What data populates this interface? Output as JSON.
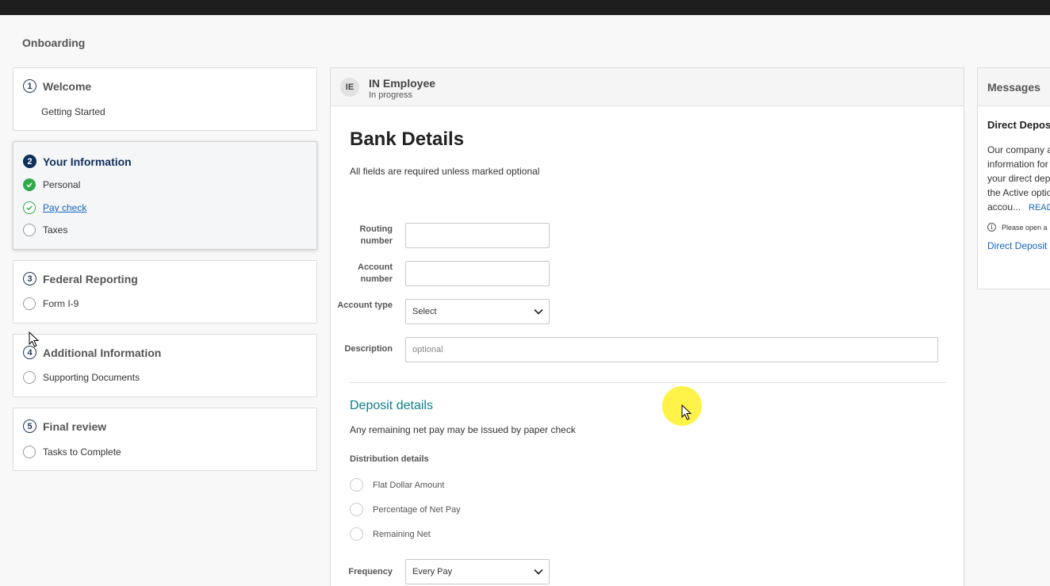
{
  "app": {
    "title": "Onboarding"
  },
  "steps": [
    {
      "number": "1",
      "title": "Welcome",
      "tasks": [
        {
          "label": "Getting Started",
          "status": "none"
        }
      ]
    },
    {
      "number": "2",
      "title": "Your Information",
      "active": true,
      "tasks": [
        {
          "label": "Personal",
          "status": "complete"
        },
        {
          "label": "Pay check",
          "status": "current"
        },
        {
          "label": "Taxes",
          "status": "pending"
        }
      ]
    },
    {
      "number": "3",
      "title": "Federal Reporting",
      "tasks": [
        {
          "label": "Form I-9",
          "status": "pending"
        }
      ]
    },
    {
      "number": "4",
      "title": "Additional Information",
      "tasks": [
        {
          "label": "Supporting Documents",
          "status": "pending"
        }
      ]
    },
    {
      "number": "5",
      "title": "Final review",
      "tasks": [
        {
          "label": "Tasks to Complete",
          "status": "pending"
        }
      ]
    }
  ],
  "employee": {
    "initials": "IE",
    "name": "IN Employee",
    "status": "In progress"
  },
  "form": {
    "title": "Bank Details",
    "subtitle": "All fields are required unless marked optional",
    "routing_label": "Routing number",
    "routing_value": "",
    "account_label": "Account number",
    "account_value": "",
    "type_label": "Account type",
    "type_value": "Select",
    "description_label": "Description",
    "description_placeholder": "optional"
  },
  "deposit": {
    "title": "Deposit details",
    "note": "Any remaining net pay may be issued by paper check",
    "distribution_label": "Distribution details",
    "options": [
      "Flat Dollar Amount",
      "Percentage of Net Pay",
      "Remaining Net"
    ],
    "frequency_label": "Frequency",
    "frequency_value": "Every Pay"
  },
  "messages": {
    "title": "Messages",
    "item_title": "Direct Deposit",
    "lines": [
      "Our company a",
      "information for",
      "your direct dep",
      "the Active optio",
      "accou..."
    ],
    "read_more": "READ MORE",
    "info_text": "Please open a",
    "link": "Direct Deposit"
  },
  "colors": {
    "brand_dark": "#0d2f5c",
    "success": "#2eaa4a",
    "link": "#1565c0",
    "section_heading": "#0e7e8e"
  },
  "icons": {
    "chevron": "chevron-down-icon",
    "check": "check-icon",
    "info": "info-icon",
    "cursor": "mouse-pointer-icon"
  }
}
